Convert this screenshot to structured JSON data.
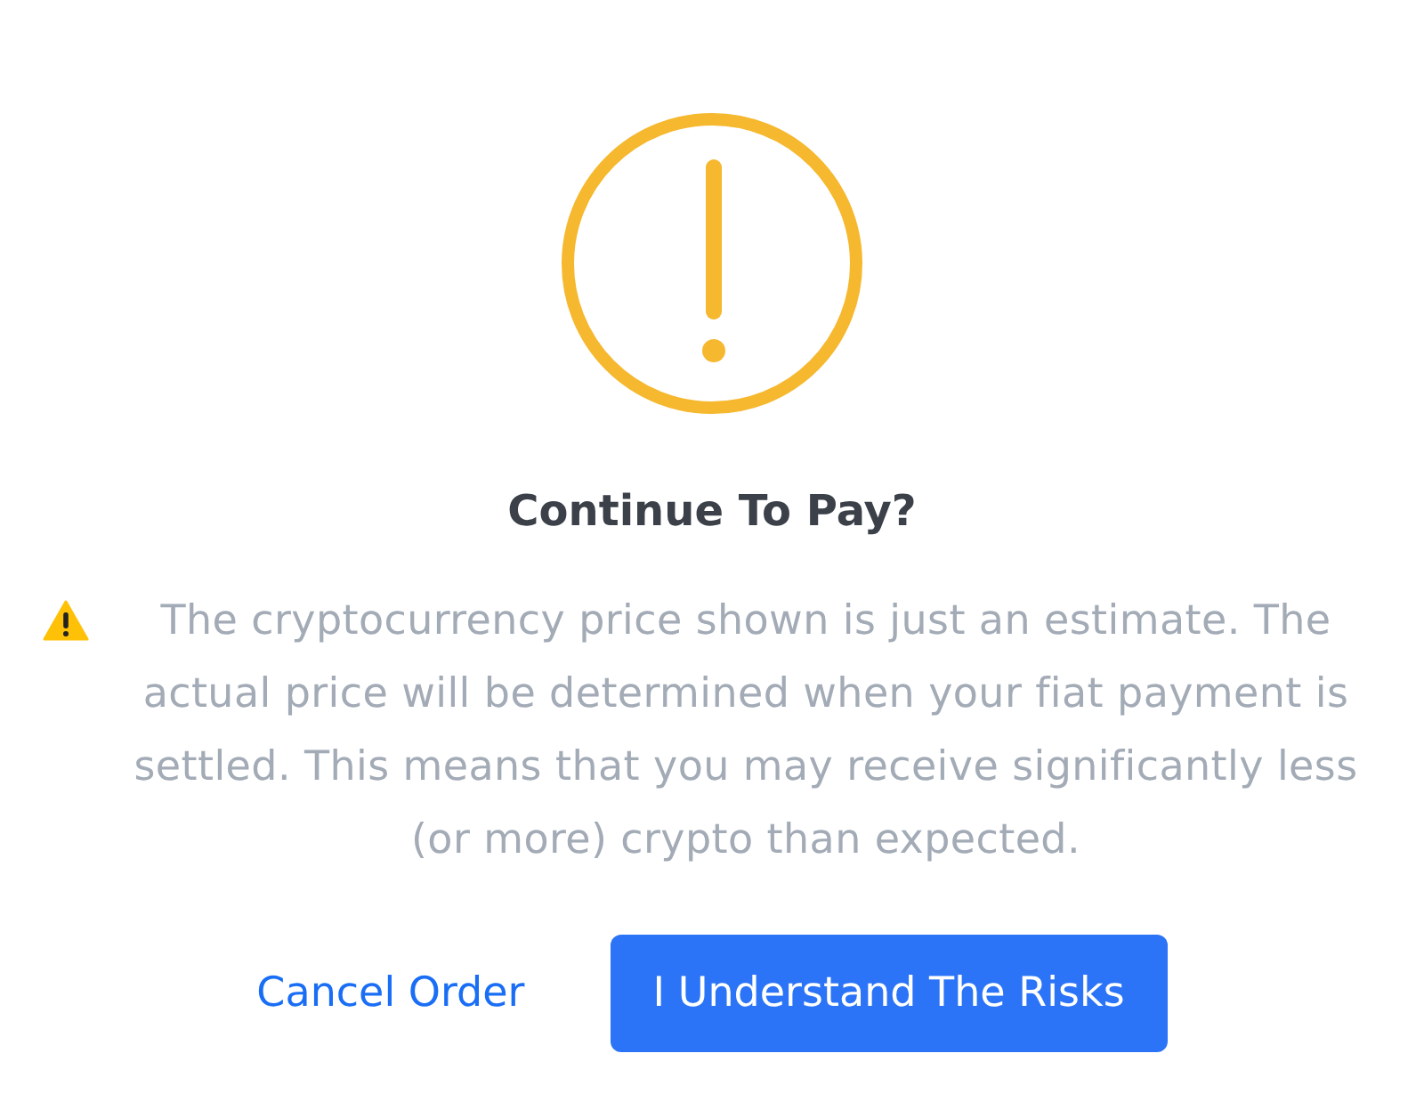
{
  "dialog": {
    "title": "Continue To Pay?",
    "message": "The cryptocurrency price shown is just an estimate. The actual price will be determined when your fiat payment is settled. This means that you may receive significantly less (or more) crypto than expected.",
    "buttons": [
      {
        "label": "Cancel Order",
        "kind": "link"
      },
      {
        "label": "I Understand The Risks",
        "kind": "primary"
      }
    ]
  }
}
